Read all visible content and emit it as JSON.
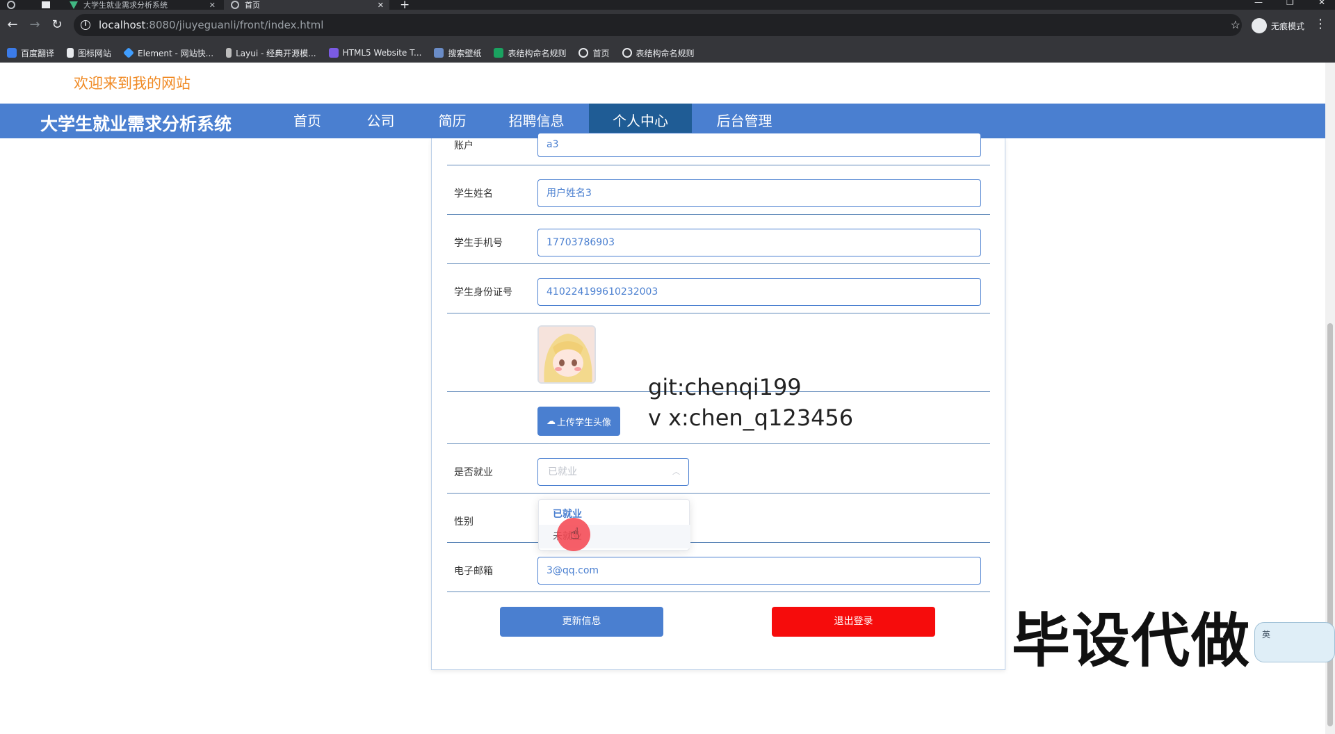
{
  "browser": {
    "tabs": [
      {
        "title": "大学生就业需求分析系统",
        "active": false
      },
      {
        "title": "首页",
        "active": true
      }
    ],
    "new_tab_symbol": "+",
    "url_host": "localhost",
    "url_path": ":8080/jiuyeguanli/front/index.html",
    "profile_label": "无痕模式",
    "bookmarks": [
      {
        "label": "百度翻译",
        "icon": "translate-icon"
      },
      {
        "label": "图标网站",
        "icon": "flag-icon"
      },
      {
        "label": "Element - 网站快...",
        "icon": "element-icon"
      },
      {
        "label": "Layui - 经典开源模...",
        "icon": "layui-icon"
      },
      {
        "label": "HTML5 Website T...",
        "icon": "html5-icon"
      },
      {
        "label": "搜索壁纸",
        "icon": "wallpaper-icon"
      },
      {
        "label": "表结构命名规则",
        "icon": "sheet-icon"
      },
      {
        "label": "首页",
        "icon": "globe-icon"
      },
      {
        "label": "表结构命名规则",
        "icon": "globe-icon"
      }
    ]
  },
  "site": {
    "welcome": "欢迎来到我的网站",
    "brand": "大学生就业需求分析系统",
    "nav": [
      "首页",
      "公司",
      "简历",
      "招聘信息",
      "个人中心",
      "后台管理"
    ],
    "active_nav": "个人中心"
  },
  "form": {
    "account": {
      "label": "账户",
      "value": "a3"
    },
    "name": {
      "label": "学生姓名",
      "value": "用户姓名3"
    },
    "phone": {
      "label": "学生手机号",
      "value": "17703786903"
    },
    "idcard": {
      "label": "学生身份证号",
      "value": "410224199610232003"
    },
    "upload_label": "上传学生头像",
    "employed": {
      "label": "是否就业",
      "value": "已就业",
      "options": [
        "已就业",
        "未就业"
      ]
    },
    "gender": {
      "label": "性别"
    },
    "email": {
      "label": "电子邮箱",
      "value": "3@qq.com"
    },
    "update_button": "更新信息",
    "logout_button": "退出登录"
  },
  "overlay": {
    "watermark_line1": "git:chenqi199",
    "watermark_line2": "v x:chen_q123456",
    "promo": "毕设代做",
    "mascot_label": "英"
  },
  "colors": {
    "nav_bg": "#4a7fd0",
    "nav_active": "#1f5c95",
    "welcome": "#f08a24",
    "logout": "#f60c0c"
  }
}
